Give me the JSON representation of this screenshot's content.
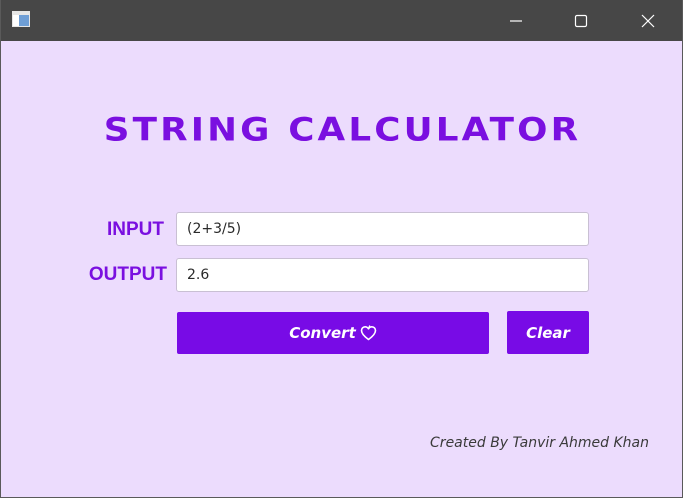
{
  "window": {
    "controls": {
      "minimize_icon": "minimize-icon",
      "maximize_icon": "maximize-icon",
      "close_icon": "close-icon"
    }
  },
  "main": {
    "title": "STRING CALCULATOR",
    "input_label": "INPUT",
    "input_value": "(2+3/5)",
    "output_label": "OUTPUT",
    "output_value": "2.6",
    "convert_label": "Convert",
    "convert_icon": "heart-icon",
    "clear_label": "Clear",
    "credit": "Created By Tanvir Ahmed Khan"
  },
  "colors": {
    "background": "#ecdcfd",
    "accent": "#780be6",
    "titlebar": "#474747"
  }
}
